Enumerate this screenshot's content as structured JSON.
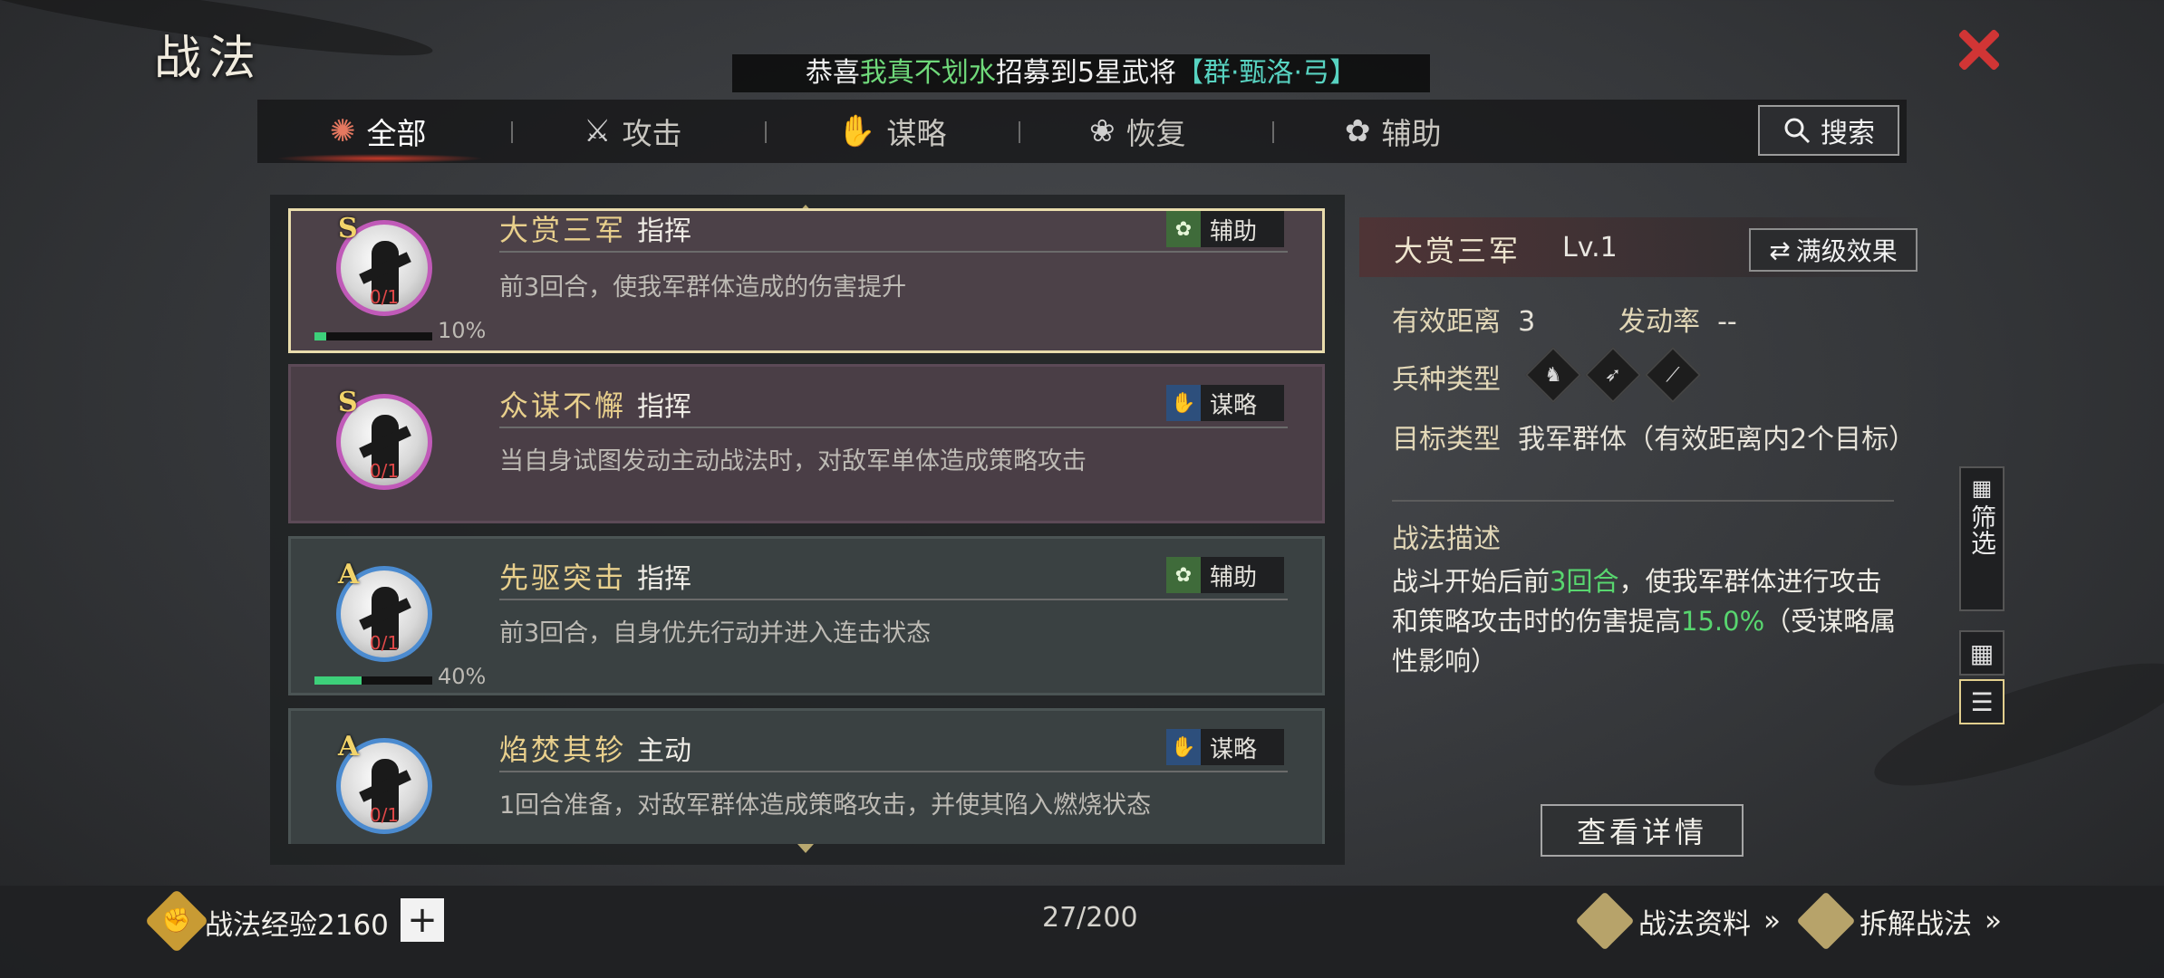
{
  "title": "战法",
  "notice": {
    "prefix": "恭喜",
    "player": "我真不划水",
    "middle": "招募到5星武将",
    "general": "【群·甄洛·弓】"
  },
  "tabs": [
    {
      "label": "全部",
      "icon": "scroll-icon",
      "glyph": "✺",
      "active": true
    },
    {
      "label": "攻击",
      "icon": "crossed-swords-icon",
      "glyph": "⚔",
      "active": false
    },
    {
      "label": "谋略",
      "icon": "fan-icon",
      "glyph": "✋",
      "active": false
    },
    {
      "label": "恢复",
      "icon": "herb-icon",
      "glyph": "❀",
      "active": false
    },
    {
      "label": "辅助",
      "icon": "bag-icon",
      "glyph": "✿",
      "active": false
    }
  ],
  "search_label": "搜索",
  "list": [
    {
      "grade": "S",
      "name": "大赏三军",
      "type": "指挥",
      "badge": "辅助",
      "badge_color": "green",
      "desc": "前3回合，使我军群体造成的伤害提升",
      "count": "0/1",
      "progress": 0.1,
      "progress_text": "10%",
      "style": "selected"
    },
    {
      "grade": "S",
      "name": "众谋不懈",
      "type": "指挥",
      "badge": "谋略",
      "badge_color": "blue",
      "desc": "当自身试图发动主动战法时，对敌军单体造成策略攻击",
      "count": "0/1",
      "progress": null,
      "progress_text": "",
      "style": "purple"
    },
    {
      "grade": "A",
      "name": "先驱突击",
      "type": "指挥",
      "badge": "辅助",
      "badge_color": "green",
      "desc": "前3回合，自身优先行动并进入连击状态",
      "count": "0/1",
      "progress": 0.4,
      "progress_text": "40%",
      "style": "teal"
    },
    {
      "grade": "A",
      "name": "焰焚其轸",
      "type": "主动",
      "badge": "谋略",
      "badge_color": "blue",
      "desc": "1回合准备，对敌军群体造成策略攻击，并使其陷入燃烧状态",
      "count": "0/1",
      "progress": null,
      "progress_text": "",
      "style": "teal"
    }
  ],
  "detail": {
    "name": "大赏三军",
    "level": "Lv.1",
    "max_effect_label": "满级效果",
    "range_label": "有效距离",
    "range_value": "3",
    "rate_label": "发动率",
    "rate_value": "--",
    "troop_label": "兵种类型",
    "troop_icons": [
      "cavalry-icon",
      "archer-icon",
      "spear-icon"
    ],
    "target_label": "目标类型",
    "target_value": "我军群体（有效距离内2个目标）",
    "desc_title": "战法描述",
    "desc_parts": {
      "p1": "战斗开始后前",
      "g1": "3回合",
      "p2": "，使我军群体进行攻击和策略攻击时的伤害提高",
      "g2": "15.0%",
      "p3": "（受谋略属性影响）"
    },
    "view_detail_label": "查看详情"
  },
  "side": {
    "filter_label": "筛选"
  },
  "bottom": {
    "exp_label": "战法经验",
    "exp_value": "2160",
    "count": "27/200",
    "info_label": "战法资料",
    "disassemble_label": "拆解战法"
  }
}
